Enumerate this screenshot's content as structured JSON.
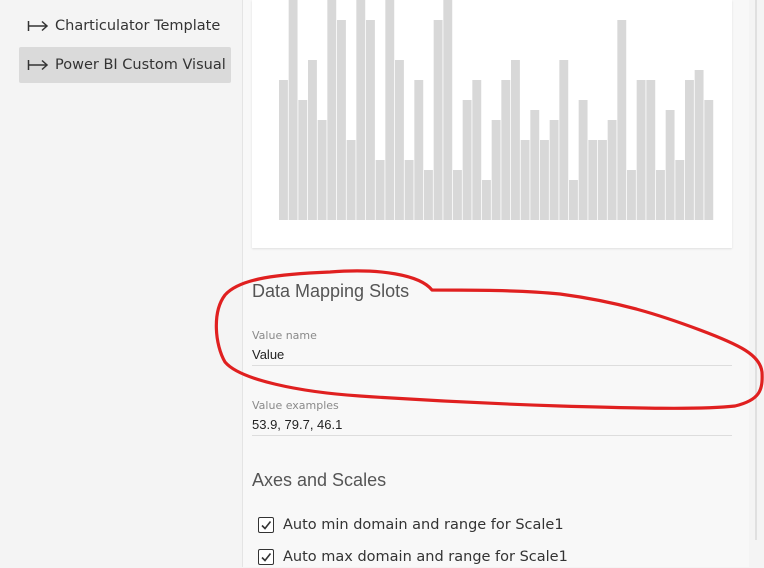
{
  "sidebar": {
    "items": [
      {
        "label": "Charticulator Template",
        "icon": "arrow-right-bar-icon",
        "selected": false
      },
      {
        "label": "Power BI Custom Visual",
        "icon": "arrow-right-bar-icon",
        "selected": true
      }
    ]
  },
  "preview": {
    "chart_data": {
      "type": "bar",
      "values": [
        140,
        240,
        120,
        160,
        100,
        240,
        200,
        80,
        220,
        200,
        60,
        240,
        160,
        60,
        140,
        50,
        200,
        240,
        50,
        120,
        140,
        40,
        100,
        140,
        160,
        80,
        110,
        80,
        100,
        160,
        40,
        120,
        80,
        80,
        100,
        200,
        50,
        140,
        140,
        50,
        110,
        60,
        140,
        150,
        120
      ],
      "ylim": [
        0,
        240
      ],
      "grid": false,
      "bar_color": "#d8d8d8"
    }
  },
  "data_mapping": {
    "title": "Data Mapping Slots",
    "value_name_label": "Value name",
    "value_name": "Value",
    "value_examples_label": "Value examples",
    "value_examples": "53.9, 79.7, 46.1"
  },
  "axes_scales": {
    "title": "Axes and Scales",
    "options": [
      {
        "label": "Auto min domain and range for Scale1",
        "checked": true
      },
      {
        "label": "Auto max domain and range for Scale1",
        "checked": true
      }
    ]
  },
  "annotation": {
    "color": "#e02020"
  }
}
